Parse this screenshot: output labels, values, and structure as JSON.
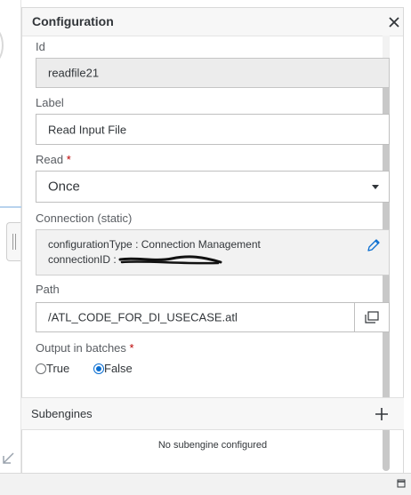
{
  "panel": {
    "title": "Configuration"
  },
  "fields": {
    "id": {
      "label": "Id",
      "value": "readfile21"
    },
    "label": {
      "label": "Label",
      "value": "Read Input File"
    },
    "read": {
      "label": "Read",
      "required_mark": "*",
      "value": "Once"
    },
    "connection": {
      "label": "Connection (static)",
      "type_key": "configurationType :",
      "type_value": "Connection Management",
      "id_key": "connectionID :"
    },
    "path": {
      "label": "Path",
      "value": "/ATL_CODE_FOR_DI_USECASE.atl"
    },
    "batches": {
      "label": "Output in batches",
      "required_mark": "*",
      "options": [
        {
          "label": "True",
          "selected": false
        },
        {
          "label": "False",
          "selected": true
        }
      ]
    }
  },
  "subengines": {
    "title": "Subengines",
    "empty_message": "No subengine configured"
  },
  "icons": {
    "close": "close-icon",
    "dropdown": "chevron-down-icon",
    "edit": "pencil-icon",
    "browse": "browse-file-icon",
    "add": "plus-icon",
    "restore": "restore-window-icon"
  },
  "colors": {
    "accent": "#0a6ed1",
    "required": "#bb0000",
    "readonly_bg": "#ececec"
  }
}
